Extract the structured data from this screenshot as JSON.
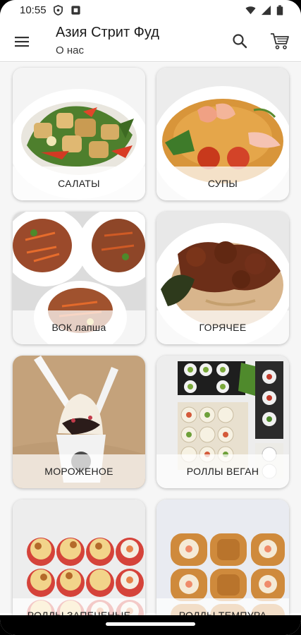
{
  "status_bar": {
    "time": "10:55"
  },
  "app_bar": {
    "title": "Азия Стрит Фуд",
    "subtitle": "О нас",
    "icons": [
      "menu-icon",
      "search-icon",
      "cart-icon"
    ]
  },
  "categories": [
    {
      "label": "САЛАТЫ"
    },
    {
      "label": "СУПЫ"
    },
    {
      "label": "ВОК лапша"
    },
    {
      "label": "ГОРЯЧЕЕ"
    },
    {
      "label": "МОРОЖЕНОЕ"
    },
    {
      "label": "РОЛЛЫ ВЕГАН"
    },
    {
      "label": "РОЛЛЫ ЗАПЕЧЕНЫЕ"
    },
    {
      "label": "РОЛЛЫ ТЕМПУРА"
    }
  ]
}
